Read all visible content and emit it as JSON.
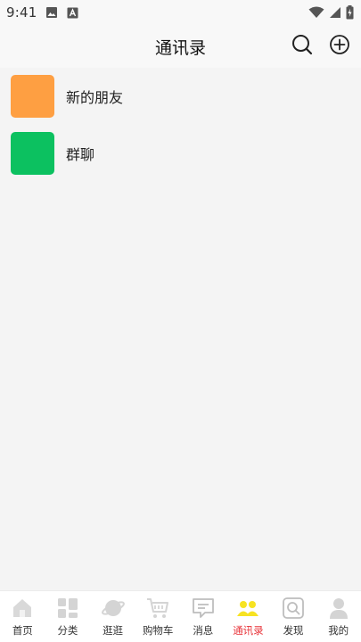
{
  "status_bar": {
    "time": "9:41"
  },
  "header": {
    "title": "通讯录"
  },
  "contacts": [
    {
      "label": "新的朋友",
      "color": "#fe9f42"
    },
    {
      "label": "群聊",
      "color": "#0cc160"
    }
  ],
  "tabbar": {
    "active_color": "#e8343a",
    "items": [
      {
        "label": "首页",
        "icon": "home-icon"
      },
      {
        "label": "分类",
        "icon": "category-icon"
      },
      {
        "label": "逛逛",
        "icon": "planet-icon"
      },
      {
        "label": "购物车",
        "icon": "cart-icon"
      },
      {
        "label": "消息",
        "icon": "message-icon"
      },
      {
        "label": "通讯录",
        "icon": "contacts-icon",
        "active": true
      },
      {
        "label": "发现",
        "icon": "discover-icon"
      },
      {
        "label": "我的",
        "icon": "profile-icon"
      }
    ]
  }
}
